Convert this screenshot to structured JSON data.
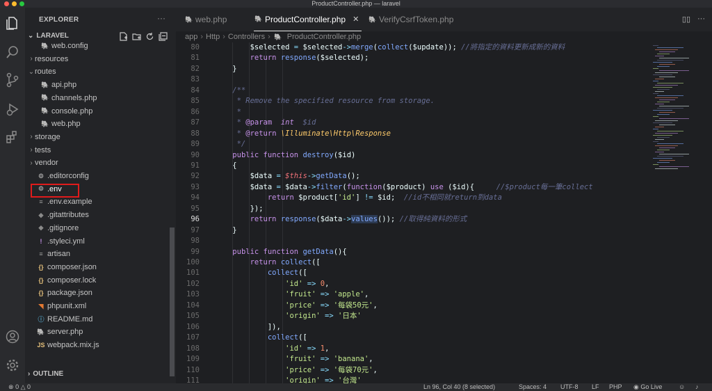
{
  "window": {
    "title": "ProductController.php — laravel"
  },
  "explorer": {
    "title": "EXPLORER",
    "project": "LARAVEL",
    "outline": "OUTLINE",
    "tree": [
      {
        "label": "web.config",
        "icon": "xml-icon",
        "depth": 1,
        "chevron": ""
      },
      {
        "label": "resources",
        "icon": "",
        "depth": 0,
        "chevron": "›"
      },
      {
        "label": "routes",
        "icon": "",
        "depth": 0,
        "chevron": "⌄"
      },
      {
        "label": "api.php",
        "icon": "php-icon",
        "depth": 1,
        "chevron": ""
      },
      {
        "label": "channels.php",
        "icon": "php-icon",
        "depth": 1,
        "chevron": ""
      },
      {
        "label": "console.php",
        "icon": "php-icon",
        "depth": 1,
        "chevron": ""
      },
      {
        "label": "web.php",
        "icon": "php-icon",
        "depth": 1,
        "chevron": ""
      },
      {
        "label": "storage",
        "icon": "",
        "depth": 0,
        "chevron": "›"
      },
      {
        "label": "tests",
        "icon": "",
        "depth": 0,
        "chevron": "›"
      },
      {
        "label": "vendor",
        "icon": "",
        "depth": 0,
        "chevron": "›"
      },
      {
        "label": ".editorconfig",
        "icon": "gear-icon",
        "depth": 0,
        "chevron": ""
      },
      {
        "label": ".env",
        "icon": "gear-icon",
        "depth": 0,
        "chevron": ""
      },
      {
        "label": ".env.example",
        "icon": "lines-icon",
        "depth": 0,
        "chevron": ""
      },
      {
        "label": ".gitattributes",
        "icon": "git-icon",
        "depth": 0,
        "chevron": ""
      },
      {
        "label": ".gitignore",
        "icon": "git-icon",
        "depth": 0,
        "chevron": ""
      },
      {
        "label": ".styleci.yml",
        "icon": "exclamation-icon",
        "depth": 0,
        "chevron": ""
      },
      {
        "label": "artisan",
        "icon": "lines-icon",
        "depth": 0,
        "chevron": ""
      },
      {
        "label": "composer.json",
        "icon": "json-icon",
        "depth": 0,
        "chevron": ""
      },
      {
        "label": "composer.lock",
        "icon": "json-icon",
        "depth": 0,
        "chevron": ""
      },
      {
        "label": "package.json",
        "icon": "json-icon",
        "depth": 0,
        "chevron": ""
      },
      {
        "label": "phpunit.xml",
        "icon": "rss-icon",
        "depth": 0,
        "chevron": ""
      },
      {
        "label": "README.md",
        "icon": "info-icon",
        "depth": 0,
        "chevron": ""
      },
      {
        "label": "server.php",
        "icon": "php-icon",
        "depth": 0,
        "chevron": ""
      },
      {
        "label": "webpack.mix.js",
        "icon": "js-icon",
        "depth": 0,
        "chevron": ""
      }
    ]
  },
  "tabs": [
    {
      "label": "web.php",
      "active": false
    },
    {
      "label": "ProductController.php",
      "active": true
    },
    {
      "label": "VerifyCsrfToken.php",
      "active": false
    }
  ],
  "breadcrumb": [
    "app",
    "Http",
    "Controllers",
    "ProductController.php"
  ],
  "editor": {
    "current_line": 96,
    "lines": [
      {
        "n": 80,
        "tokens": [
          [
            "pl",
            "        "
          ],
          [
            "var",
            "$selected"
          ],
          [
            "op",
            " = "
          ],
          [
            "var",
            "$selected"
          ],
          [
            "op",
            "->"
          ],
          [
            "fn",
            "merge"
          ],
          [
            "pl",
            "("
          ],
          [
            "fn",
            "collect"
          ],
          [
            "pl",
            "("
          ],
          [
            "var",
            "$update"
          ],
          [
            "pl",
            "));"
          ],
          [
            "cmt",
            " //將指定的資料更新成新的資料"
          ]
        ]
      },
      {
        "n": 81,
        "tokens": [
          [
            "pl",
            "        "
          ],
          [
            "kw",
            "return"
          ],
          [
            "pl",
            " "
          ],
          [
            "fn",
            "response"
          ],
          [
            "pl",
            "("
          ],
          [
            "var",
            "$selected"
          ],
          [
            "pl",
            ");"
          ]
        ]
      },
      {
        "n": 82,
        "tokens": [
          [
            "pl",
            "    }"
          ]
        ]
      },
      {
        "n": 83,
        "tokens": []
      },
      {
        "n": 84,
        "tokens": [
          [
            "cmt",
            "    /**"
          ]
        ]
      },
      {
        "n": 85,
        "tokens": [
          [
            "cmt",
            "     * Remove the specified resource from storage."
          ]
        ]
      },
      {
        "n": 86,
        "tokens": [
          [
            "cmt",
            "     *"
          ]
        ]
      },
      {
        "n": 87,
        "tokens": [
          [
            "cmt",
            "     * "
          ],
          [
            "kw",
            "@param"
          ],
          [
            "cmt",
            "  "
          ],
          [
            "ty",
            "int"
          ],
          [
            "cmt",
            "  $id"
          ]
        ]
      },
      {
        "n": 88,
        "tokens": [
          [
            "cmt",
            "     * "
          ],
          [
            "kw",
            "@return"
          ],
          [
            "cmt",
            " "
          ],
          [
            "cls",
            "\\Illuminate\\Http\\Response"
          ]
        ]
      },
      {
        "n": 89,
        "tokens": [
          [
            "cmt",
            "     */"
          ]
        ]
      },
      {
        "n": 90,
        "tokens": [
          [
            "pl",
            "    "
          ],
          [
            "kw",
            "public function"
          ],
          [
            "pl",
            " "
          ],
          [
            "fn",
            "destroy"
          ],
          [
            "pl",
            "("
          ],
          [
            "var",
            "$id"
          ],
          [
            "pl",
            ")"
          ]
        ]
      },
      {
        "n": 91,
        "tokens": [
          [
            "pl",
            "    {"
          ]
        ]
      },
      {
        "n": 92,
        "tokens": [
          [
            "pl",
            "        "
          ],
          [
            "var",
            "$data"
          ],
          [
            "op",
            " = "
          ],
          [
            "this",
            "$this"
          ],
          [
            "op",
            "->"
          ],
          [
            "fn",
            "getData"
          ],
          [
            "pl",
            "();"
          ]
        ]
      },
      {
        "n": 93,
        "tokens": [
          [
            "pl",
            "        "
          ],
          [
            "var",
            "$data"
          ],
          [
            "op",
            " = "
          ],
          [
            "var",
            "$data"
          ],
          [
            "op",
            "->"
          ],
          [
            "fn",
            "filter"
          ],
          [
            "pl",
            "("
          ],
          [
            "kw",
            "function"
          ],
          [
            "pl",
            "("
          ],
          [
            "var",
            "$product"
          ],
          [
            "pl",
            ") "
          ],
          [
            "kw",
            "use"
          ],
          [
            "pl",
            " ("
          ],
          [
            "var",
            "$id"
          ],
          [
            "pl",
            "){     "
          ],
          [
            "cmt",
            "//$product每一筆collect"
          ]
        ]
      },
      {
        "n": 94,
        "tokens": [
          [
            "pl",
            "            "
          ],
          [
            "kw",
            "return"
          ],
          [
            "pl",
            " "
          ],
          [
            "var",
            "$product"
          ],
          [
            "pl",
            "["
          ],
          [
            "str",
            "'id'"
          ],
          [
            "pl",
            "] "
          ],
          [
            "op",
            "!="
          ],
          [
            "pl",
            " "
          ],
          [
            "var",
            "$id"
          ],
          [
            "pl",
            ";  "
          ],
          [
            "cmt",
            "//id不相同就return到data"
          ]
        ]
      },
      {
        "n": 95,
        "tokens": [
          [
            "pl",
            "        });"
          ]
        ]
      },
      {
        "n": 96,
        "tokens": [
          [
            "pl",
            "        "
          ],
          [
            "kw",
            "return"
          ],
          [
            "pl",
            " "
          ],
          [
            "fn",
            "response"
          ],
          [
            "pl",
            "("
          ],
          [
            "var",
            "$data"
          ],
          [
            "op",
            "->"
          ],
          [
            "fn",
            "values"
          ],
          [
            "pl",
            "()); "
          ],
          [
            "cmt",
            "//取得純資料的形式"
          ]
        ]
      },
      {
        "n": 97,
        "tokens": [
          [
            "pl",
            "    }"
          ]
        ]
      },
      {
        "n": 98,
        "tokens": []
      },
      {
        "n": 99,
        "tokens": [
          [
            "pl",
            "    "
          ],
          [
            "kw",
            "public function"
          ],
          [
            "pl",
            " "
          ],
          [
            "fn",
            "getData"
          ],
          [
            "pl",
            "(){"
          ]
        ]
      },
      {
        "n": 100,
        "tokens": [
          [
            "pl",
            "        "
          ],
          [
            "kw",
            "return"
          ],
          [
            "pl",
            " "
          ],
          [
            "fn",
            "collect"
          ],
          [
            "pl",
            "(["
          ]
        ]
      },
      {
        "n": 101,
        "tokens": [
          [
            "pl",
            "            "
          ],
          [
            "fn",
            "collect"
          ],
          [
            "pl",
            "(["
          ]
        ]
      },
      {
        "n": 102,
        "tokens": [
          [
            "pl",
            "                "
          ],
          [
            "str",
            "'id'"
          ],
          [
            "op",
            " => "
          ],
          [
            "num",
            "0"
          ],
          [
            "pl",
            ","
          ]
        ]
      },
      {
        "n": 103,
        "tokens": [
          [
            "pl",
            "                "
          ],
          [
            "str",
            "'fruit'"
          ],
          [
            "op",
            " => "
          ],
          [
            "str",
            "'apple'"
          ],
          [
            "pl",
            ","
          ]
        ]
      },
      {
        "n": 104,
        "tokens": [
          [
            "pl",
            "                "
          ],
          [
            "str",
            "'price'"
          ],
          [
            "op",
            " => "
          ],
          [
            "str",
            "'每袋50元'"
          ],
          [
            "pl",
            ","
          ]
        ]
      },
      {
        "n": 105,
        "tokens": [
          [
            "pl",
            "                "
          ],
          [
            "str",
            "'origin'"
          ],
          [
            "op",
            " => "
          ],
          [
            "str",
            "'日本'"
          ]
        ]
      },
      {
        "n": 106,
        "tokens": [
          [
            "pl",
            "            ]),"
          ]
        ]
      },
      {
        "n": 107,
        "tokens": [
          [
            "pl",
            "            "
          ],
          [
            "fn",
            "collect"
          ],
          [
            "pl",
            "(["
          ]
        ]
      },
      {
        "n": 108,
        "tokens": [
          [
            "pl",
            "                "
          ],
          [
            "str",
            "'id'"
          ],
          [
            "op",
            " => "
          ],
          [
            "num",
            "1"
          ],
          [
            "pl",
            ","
          ]
        ]
      },
      {
        "n": 109,
        "tokens": [
          [
            "pl",
            "                "
          ],
          [
            "str",
            "'fruit'"
          ],
          [
            "op",
            " => "
          ],
          [
            "str",
            "'banana'"
          ],
          [
            "pl",
            ","
          ]
        ]
      },
      {
        "n": 110,
        "tokens": [
          [
            "pl",
            "                "
          ],
          [
            "str",
            "'price'"
          ],
          [
            "op",
            " => "
          ],
          [
            "str",
            "'每袋70元'"
          ],
          [
            "pl",
            ","
          ]
        ]
      },
      {
        "n": 111,
        "tokens": [
          [
            "pl",
            "                "
          ],
          [
            "str",
            "'origin'"
          ],
          [
            "op",
            " => "
          ],
          [
            "str",
            "'台灣'"
          ]
        ]
      }
    ]
  },
  "status": {
    "errors": "0",
    "warnings": "0",
    "position": "Ln 96, Col 40 (8 selected)",
    "spaces": "Spaces: 4",
    "encoding": "UTF-8",
    "eol": "LF",
    "language": "PHP",
    "live": "Go Live"
  },
  "colors": {
    "highlight_box": "#e01b1b",
    "accent": "#82aaff"
  }
}
